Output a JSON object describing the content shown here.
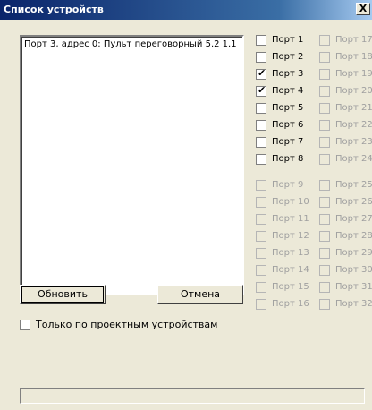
{
  "window": {
    "title": "Список устройств",
    "close_label": "X"
  },
  "device_list": {
    "items": [
      "Порт 3, адрес 0: Пульт переговорный 5.2 1.1"
    ]
  },
  "ports": [
    {
      "label": "Порт 1",
      "checked": false,
      "enabled": true
    },
    {
      "label": "Порт 2",
      "checked": false,
      "enabled": true
    },
    {
      "label": "Порт 3",
      "checked": true,
      "enabled": true
    },
    {
      "label": "Порт 4",
      "checked": true,
      "enabled": true
    },
    {
      "label": "Порт 5",
      "checked": false,
      "enabled": true
    },
    {
      "label": "Порт 6",
      "checked": false,
      "enabled": true
    },
    {
      "label": "Порт 7",
      "checked": false,
      "enabled": true
    },
    {
      "label": "Порт 8",
      "checked": false,
      "enabled": true
    },
    {
      "label": "Порт 9",
      "checked": false,
      "enabled": false
    },
    {
      "label": "Порт 10",
      "checked": false,
      "enabled": false
    },
    {
      "label": "Порт 11",
      "checked": false,
      "enabled": false
    },
    {
      "label": "Порт 12",
      "checked": false,
      "enabled": false
    },
    {
      "label": "Порт 13",
      "checked": false,
      "enabled": false
    },
    {
      "label": "Порт 14",
      "checked": false,
      "enabled": false
    },
    {
      "label": "Порт 15",
      "checked": false,
      "enabled": false
    },
    {
      "label": "Порт 16",
      "checked": false,
      "enabled": false
    },
    {
      "label": "Порт 17",
      "checked": false,
      "enabled": false
    },
    {
      "label": "Порт 18",
      "checked": false,
      "enabled": false
    },
    {
      "label": "Порт 19",
      "checked": false,
      "enabled": false
    },
    {
      "label": "Порт 20",
      "checked": false,
      "enabled": false
    },
    {
      "label": "Порт 21",
      "checked": false,
      "enabled": false
    },
    {
      "label": "Порт 22",
      "checked": false,
      "enabled": false
    },
    {
      "label": "Порт 23",
      "checked": false,
      "enabled": false
    },
    {
      "label": "Порт 24",
      "checked": false,
      "enabled": false
    },
    {
      "label": "Порт 25",
      "checked": false,
      "enabled": false
    },
    {
      "label": "Порт 26",
      "checked": false,
      "enabled": false
    },
    {
      "label": "Порт 27",
      "checked": false,
      "enabled": false
    },
    {
      "label": "Порт 28",
      "checked": false,
      "enabled": false
    },
    {
      "label": "Порт 29",
      "checked": false,
      "enabled": false
    },
    {
      "label": "Порт 30",
      "checked": false,
      "enabled": false
    },
    {
      "label": "Порт 31",
      "checked": false,
      "enabled": false
    },
    {
      "label": "Порт 32",
      "checked": false,
      "enabled": false
    }
  ],
  "buttons": {
    "refresh": "Обновить",
    "cancel": "Отмена"
  },
  "filter": {
    "label": "Только по проектным устройствам",
    "checked": false
  },
  "colors": {
    "title_start": "#0a246a",
    "title_end": "#a6caf0",
    "face": "#ece9d8",
    "disabled_text": "#a0a0a0"
  }
}
